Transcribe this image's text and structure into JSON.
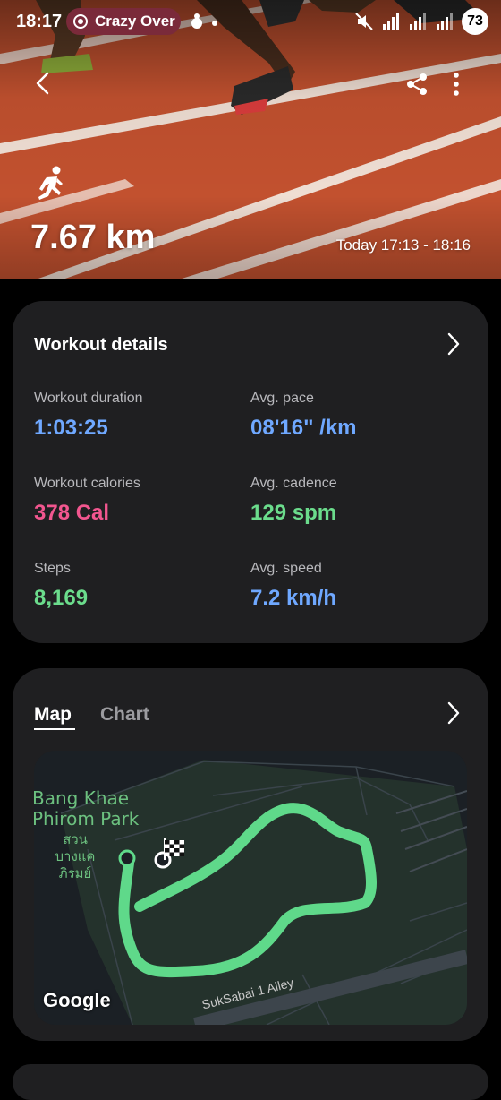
{
  "status_bar": {
    "time": "18:17",
    "media_label": "Crazy Over",
    "battery": "73"
  },
  "hero": {
    "distance": "7.67 km",
    "time_range": "Today 17:13 - 18:16",
    "icon": "running-person-icon"
  },
  "workout_details": {
    "title": "Workout details",
    "metrics": [
      {
        "label": "Workout duration",
        "value": "1:03:25",
        "unit": "",
        "color": "#6fa8ff"
      },
      {
        "label": "Avg. pace",
        "value": "08'16\" /km",
        "unit": "",
        "color": "#6fa8ff"
      },
      {
        "label": "Workout calories",
        "value": "378",
        "unit": "Cal",
        "color": "#f2568f"
      },
      {
        "label": "Avg. cadence",
        "value": "129",
        "unit": "spm",
        "color": "#6bdc8c"
      },
      {
        "label": "Steps",
        "value": "8,169",
        "unit": "",
        "color": "#6bdc8c"
      },
      {
        "label": "Avg. speed",
        "value": "7.2",
        "unit": "km/h",
        "color": "#6fa8ff"
      }
    ]
  },
  "map_card": {
    "tabs": [
      {
        "label": "Map",
        "selected": true
      },
      {
        "label": "Chart",
        "selected": false
      }
    ],
    "park_name": "Bang Khae Phirom Park",
    "park_name_line1": "Bang Khae",
    "park_name_line2": "Phirom Park",
    "park_name_th_line1": "สวนบางแค",
    "park_name_th_line2": "ภิรมย์",
    "road_label": "SukSabai 1 Alley",
    "map_attribution": "Google",
    "route_color": "#5fd98a"
  }
}
